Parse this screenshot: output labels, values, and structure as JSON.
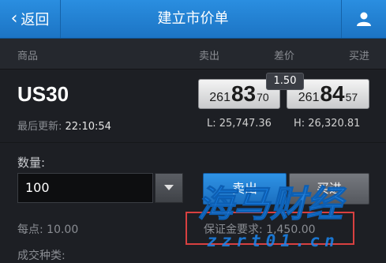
{
  "header": {
    "back_label": "返回",
    "title": "建立市价单"
  },
  "columns": {
    "product": "商品",
    "sell": "卖出",
    "spread": "差价",
    "buy": "买进"
  },
  "quote": {
    "symbol": "US30",
    "spread": "1.50",
    "sell": {
      "pre": "261",
      "big": "83",
      "post": "70"
    },
    "buy": {
      "pre": "261",
      "big": "84",
      "post": "57"
    },
    "last_update_label": "最后更新:",
    "last_update_time": "22:10:54",
    "low": "L: 25,747.36",
    "high": "H: 26,320.81"
  },
  "order": {
    "quantity_label": "数量:",
    "quantity_value": "100",
    "sell_button": "卖出",
    "buy_button": "买进",
    "per_point": "每点: 10.00",
    "margin": "保证金要求: 1,450.00",
    "cutoff_text": "成交种类:"
  },
  "watermark": {
    "brand": "海马财经",
    "url": "zzrt01.cn"
  },
  "colors": {
    "header_blue": "#1c74c4",
    "background": "#1d1f24",
    "sell_button": "#2285d8",
    "highlight_red": "#d84040",
    "watermark_blue": "#1a86f0"
  }
}
